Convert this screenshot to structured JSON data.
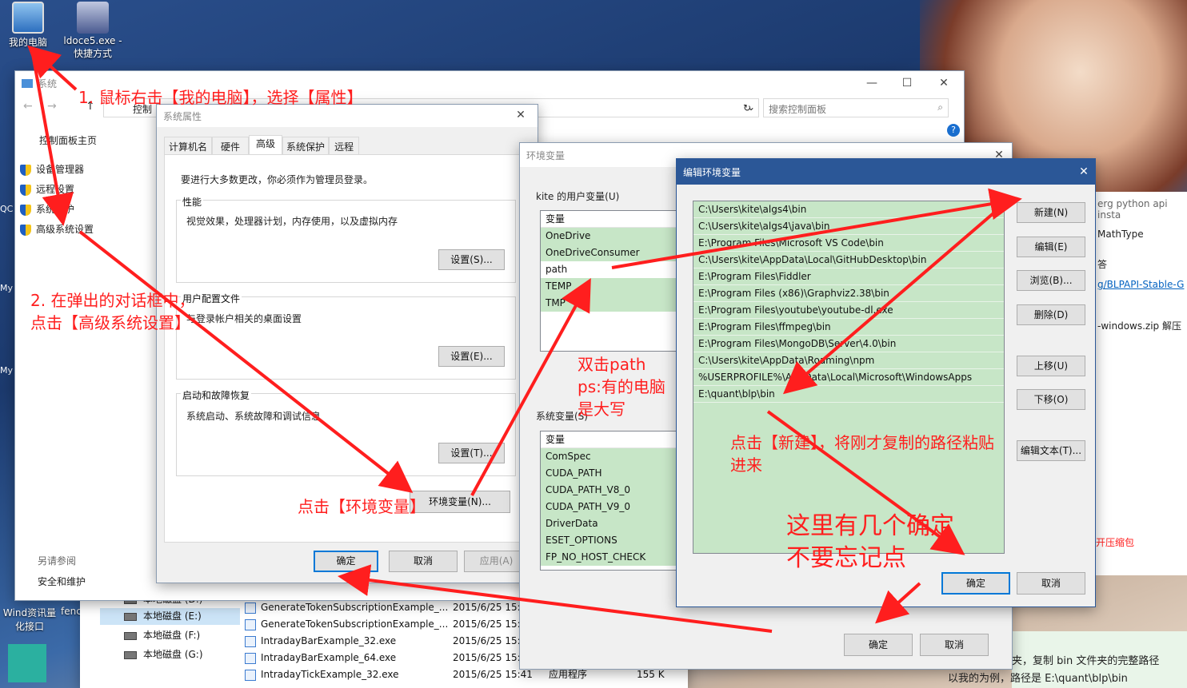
{
  "desktop": {
    "icons": [
      {
        "label": "我的电脑",
        "icon": "computer-icon"
      },
      {
        "label": "ldoce5.exe - 快捷方式",
        "icon": "shortcut-icon"
      }
    ],
    "left_strip": [
      "QC",
      "My",
      "My",
      "Wind资讯量化接口",
      "fenc"
    ]
  },
  "system_window": {
    "title": "系统",
    "address": "控制",
    "search_placeholder": "搜索控制面板",
    "sidebar_home": "控制面板主页",
    "sidebar_items": [
      "设备管理器",
      "远程设置",
      "系统保护",
      "高级系统设置"
    ],
    "see_also": "另请参阅",
    "see_also_item": "安全和维护"
  },
  "sysprops": {
    "title": "系统属性",
    "tabs": [
      "计算机名",
      "硬件",
      "高级",
      "系统保护",
      "远程"
    ],
    "admin_note": "要进行大多数更改，你必须作为管理员登录。",
    "perf_title": "性能",
    "perf_desc": "视觉效果，处理器计划，内存使用，以及虚拟内存",
    "perf_btn": "设置(S)...",
    "profile_title": "用户配置文件",
    "profile_desc": "与登录帐户相关的桌面设置",
    "profile_btn": "设置(E)...",
    "startup_title": "启动和故障恢复",
    "startup_desc": "系统启动、系统故障和调试信息",
    "startup_btn": "设置(T)...",
    "env_btn": "环境变量(N)...",
    "ok": "确定",
    "cancel": "取消",
    "apply": "应用(A)"
  },
  "envvars": {
    "title": "环境变量",
    "user_label": "kite 的用户变量(U)",
    "user_header": "变量",
    "user_vars": [
      "OneDrive",
      "OneDriveConsumer",
      "path",
      "TEMP",
      "TMP"
    ],
    "sys_label": "系统变量(S)",
    "sys_header": "变量",
    "sys_vars": [
      "ComSpec",
      "CUDA_PATH",
      "CUDA_PATH_V8_0",
      "CUDA_PATH_V9_0",
      "DriverData",
      "ESET_OPTIONS",
      "FP_NO_HOST_CHECK"
    ],
    "ok": "确定",
    "cancel": "取消"
  },
  "edit_env": {
    "title": "编辑环境变量",
    "paths": [
      "C:\\Users\\kite\\algs4\\bin",
      "C:\\Users\\kite\\algs4\\java\\bin",
      "E:\\Program Files\\Microsoft VS Code\\bin",
      "C:\\Users\\kite\\AppData\\Local\\GitHubDesktop\\bin",
      "E:\\Program Files\\Fiddler",
      "E:\\Program Files (x86)\\Graphviz2.38\\bin",
      "E:\\Program Files\\youtube\\youtube-dl.exe",
      "E:\\Program Files\\ffmpeg\\bin",
      "E:\\Program Files\\MongoDB\\Server\\4.0\\bin",
      "C:\\Users\\kite\\AppData\\Roaming\\npm",
      "%USERPROFILE%\\AppData\\Local\\Microsoft\\WindowsApps",
      "E:\\quant\\blp\\bin"
    ],
    "buttons": [
      "新建(N)",
      "编辑(E)",
      "浏览(B)...",
      "删除(D)",
      "上移(U)",
      "下移(O)",
      "编辑文本(T)..."
    ],
    "ok": "确定",
    "cancel": "取消"
  },
  "explorer": {
    "drives": [
      "本地磁盘 (D:)",
      "本地磁盘 (E:)",
      "本地磁盘 (F:)",
      "本地磁盘 (G:)"
    ],
    "files": [
      {
        "name": "GenerateTokenSubscriptionExample_...",
        "date": "2015/6/25 15:4"
      },
      {
        "name": "GenerateTokenSubscriptionExample_...",
        "date": "2015/6/25 15:4"
      },
      {
        "name": "IntradayBarExample_32.exe",
        "date": "2015/6/25 15:4"
      },
      {
        "name": "IntradayBarExample_64.exe",
        "date": "2015/6/25 15:4"
      },
      {
        "name": "IntradayTickExample_32.exe",
        "date": "2015/6/25 15:41",
        "type": "应用程序",
        "size": "155 K"
      }
    ]
  },
  "right_doc": {
    "lines": [
      "erg python api insta",
      "MathType",
      "告",
      "答",
      "g/BLPAPI-Stable-G",
      "-windows.zip 解压",
      "开压缩包"
    ],
    "bottom1": "夹，复制 bin 文件夹的完整路径",
    "bottom2": "以我的为例，路径是 E:\\quant\\blp\\bin"
  },
  "annotations": {
    "step1": "1. 鼠标右击【我的电脑】，选择【属性】",
    "step2a": "2. 在弹出的对话框中，",
    "step2b": "点击【高级系统设置】",
    "step3": "点击【环境变量】",
    "step4a": "双击path",
    "step4b": "ps:有的电脑",
    "step4c": "是大写",
    "step5a": "点击【新建】，将刚才复制的路径粘贴",
    "step5b": "进来",
    "step6a": "这里有几个确定",
    "step6b": "不要忘记点",
    "arrow_color": "#ff1e1e"
  }
}
